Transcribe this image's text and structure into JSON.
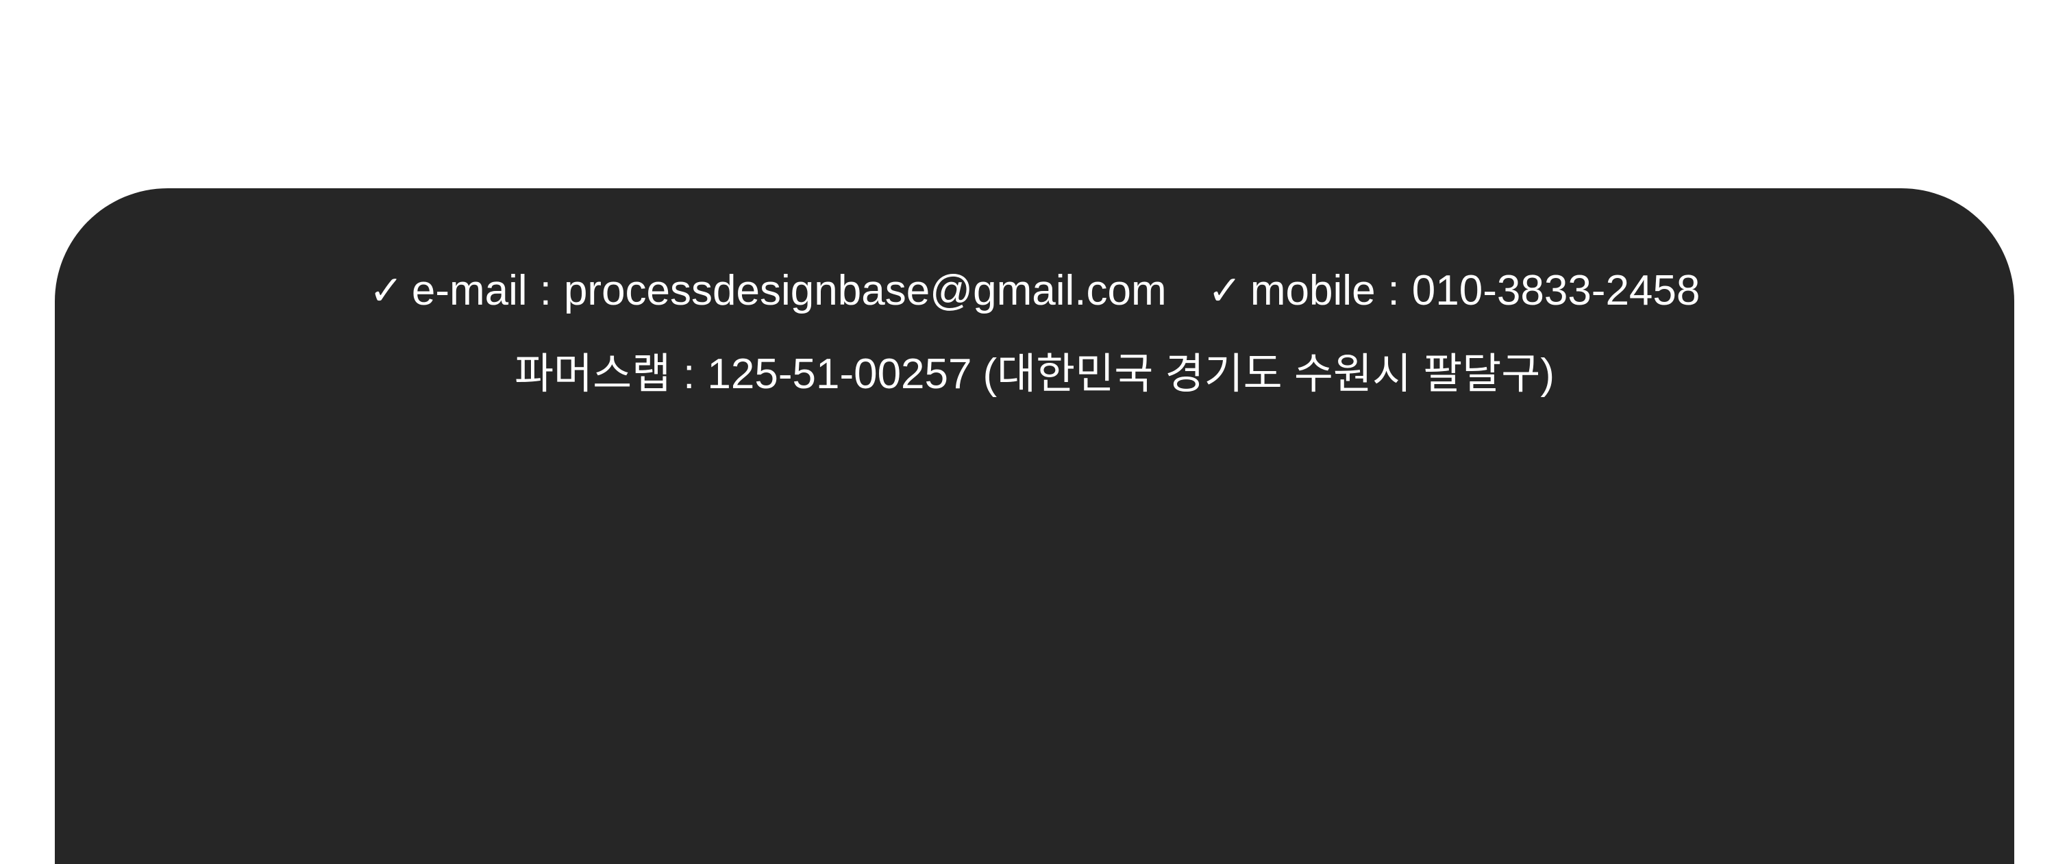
{
  "contact": {
    "email_label": "e-mail",
    "email_separator": ":",
    "email_value": "processdesignbase@gmail.com",
    "mobile_label": "mobile",
    "mobile_separator": ":",
    "mobile_value": "010-3833-2458",
    "check_symbol": "✓"
  },
  "business": {
    "name": "파머스랩",
    "separator": ":",
    "registration": "125-51-00257",
    "location": "(대한민국 경기도 수원시 팔달구)"
  },
  "colors": {
    "panel_background": "#262626",
    "page_background": "#ffffff",
    "text": "#ffffff"
  },
  "icons": {
    "email_check": "check-icon",
    "mobile_check": "check-icon"
  }
}
